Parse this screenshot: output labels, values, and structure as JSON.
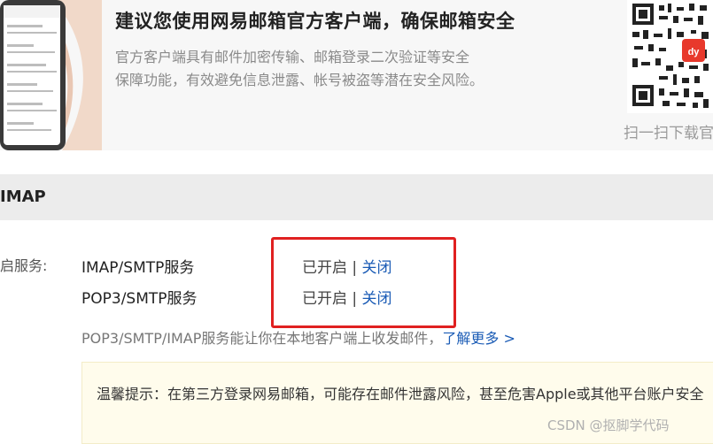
{
  "banner": {
    "title": "建议您使用网易邮箱官方客户端，确保邮箱安全",
    "desc_line1": "官方客户端具有邮件加密传输、邮箱登录二次验证等安全",
    "desc_line2": "保障功能，有效避免信息泄露、帐号被盗等潜在安全风险。",
    "qr_caption": "扫一扫下载官"
  },
  "section": {
    "title": "IMAP",
    "row_label": "启服务:"
  },
  "services": [
    {
      "name": "IMAP/SMTP服务",
      "status": "已开启",
      "separator": "|",
      "action": "关闭"
    },
    {
      "name": "POP3/SMTP服务",
      "status": "已开启",
      "separator": "|",
      "action": "关闭"
    }
  ],
  "info": {
    "text": "POP3/SMTP/IMAP服务能让你在本地客户端上收发邮件，",
    "link": "了解更多 >"
  },
  "tip": {
    "text": "温馨提示：在第三方登录网易邮箱，可能存在邮件泄露风险，甚至危害Apple或其他平台账户安全"
  },
  "watermark": "CSDN @抠脚学代码",
  "colors": {
    "link": "#1a5bb5",
    "highlight_border": "#e02020",
    "tip_bg": "#fffcec",
    "section_bg": "#ececec"
  }
}
